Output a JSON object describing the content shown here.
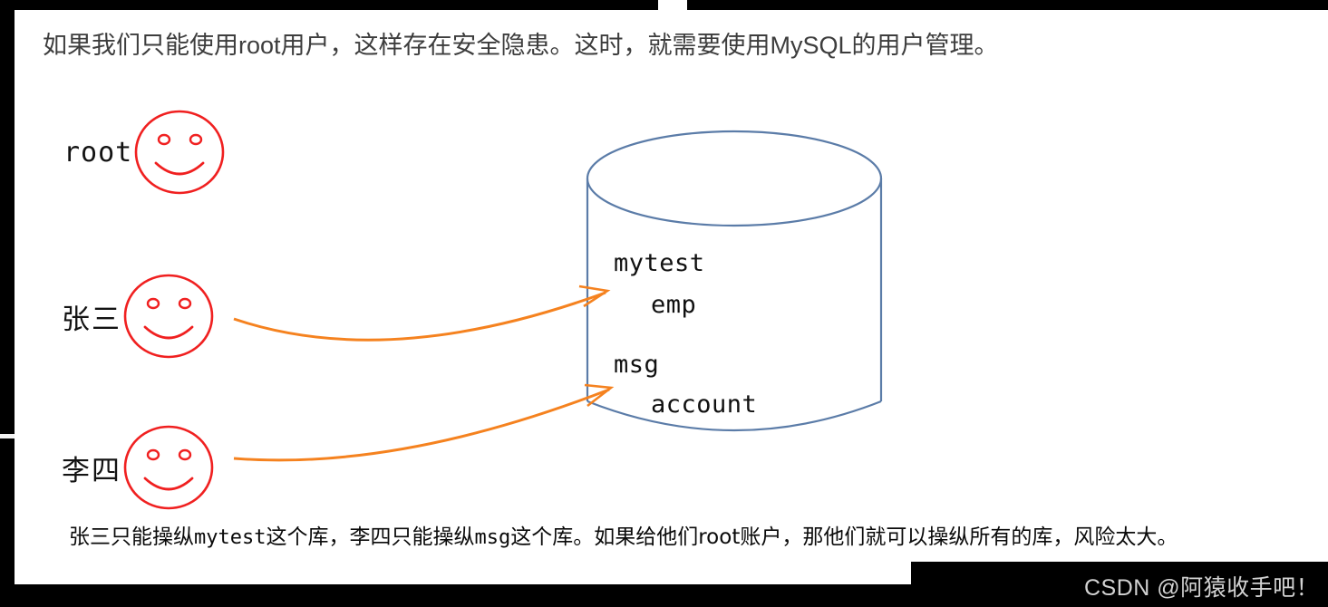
{
  "heading": {
    "text": "如果我们只能使用root用户，这样存在安全隐患。这时，就需要使用MySQL的用户管理。"
  },
  "users": [
    {
      "label": "root",
      "face_icon": "smiley-face-icon",
      "color": "#F02020"
    },
    {
      "label": "张三",
      "face_icon": "smiley-face-icon",
      "color": "#F02020"
    },
    {
      "label": "李四",
      "face_icon": "smiley-face-icon",
      "color": "#F02020"
    }
  ],
  "database": {
    "shape_icon": "database-cylinder-icon",
    "stroke_color": "#5B7CA8",
    "entries": [
      {
        "name": "mytest",
        "level": 0
      },
      {
        "name": "emp",
        "level": 1
      },
      {
        "name": "msg",
        "level": 0
      },
      {
        "name": "account",
        "level": 1
      }
    ]
  },
  "arrows": [
    {
      "from": "张三",
      "to": "mytest",
      "color": "#F5821F",
      "icon": "curved-arrow-icon"
    },
    {
      "from": "李四",
      "to": "msg",
      "color": "#F5821F",
      "icon": "curved-arrow-icon"
    }
  ],
  "caption": {
    "part1": "张三只能操纵",
    "db1": "mytest",
    "part2": "这个库，李四只能操纵",
    "db2": "msg",
    "part3": "这个库。如果给他们root账户，那他们就可以操纵所有的库，风险太大。"
  },
  "watermark": {
    "text": "CSDN @阿猿收手吧！"
  }
}
